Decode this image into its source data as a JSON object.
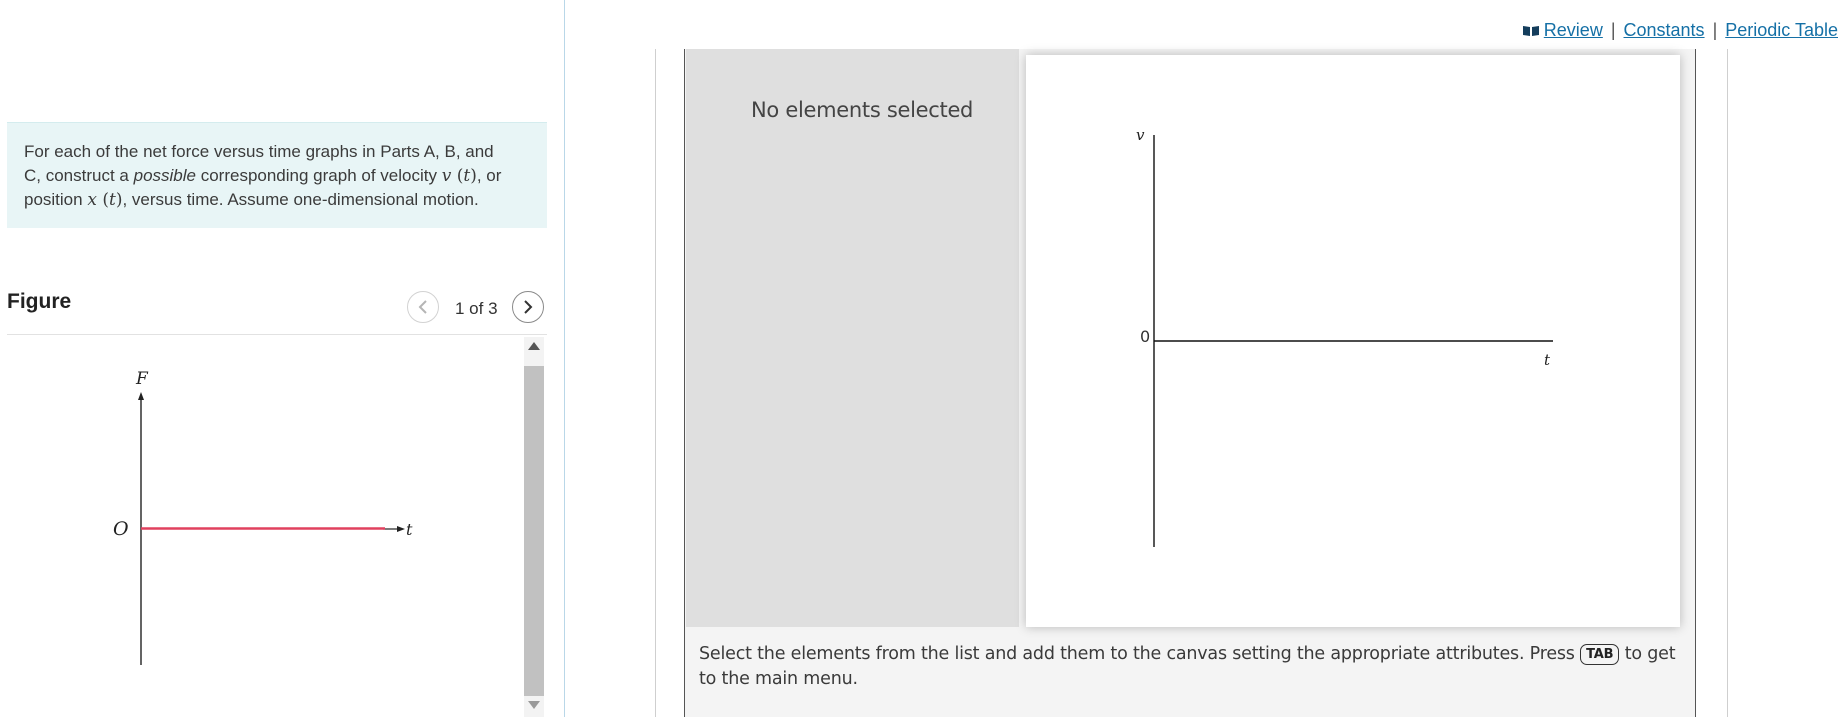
{
  "intro": {
    "line1": "For each of the net force versus time graphs in Parts A, B, and",
    "line2_pre": "C, construct a ",
    "line2_em": "possible",
    "line2_post": " corresponding graph of velocity ",
    "v_sym": "v",
    "t_sym": "t",
    "line2_end": ", or",
    "line3_pre": "position ",
    "x_sym": "x",
    "line3_post": ", versus time. Assume one-dimensional motion."
  },
  "figure": {
    "title": "Figure",
    "page_indicator": "1 of 3",
    "graph": {
      "y_label": "F",
      "origin_label": "O",
      "x_label": "t",
      "line_color": "#e0405e"
    }
  },
  "top_links": {
    "review": "Review",
    "constants": "Constants",
    "periodic_table": "Periodic Table",
    "separator": "|"
  },
  "workspace": {
    "selection_status": "No elements selected",
    "canvas": {
      "y_label": "v",
      "zero_label": "0",
      "x_label": "t"
    },
    "instructions_pre": "Select the elements from the list and add them to the canvas setting the appropriate attributes. Press ",
    "instructions_key": "TAB",
    "instructions_post": " to get to the main menu."
  },
  "icons": {
    "review": "book-icon",
    "prev": "chevron-left-icon",
    "next": "chevron-right-icon",
    "scroll_up": "triangle-up-icon",
    "scroll_down": "triangle-down-icon"
  }
}
